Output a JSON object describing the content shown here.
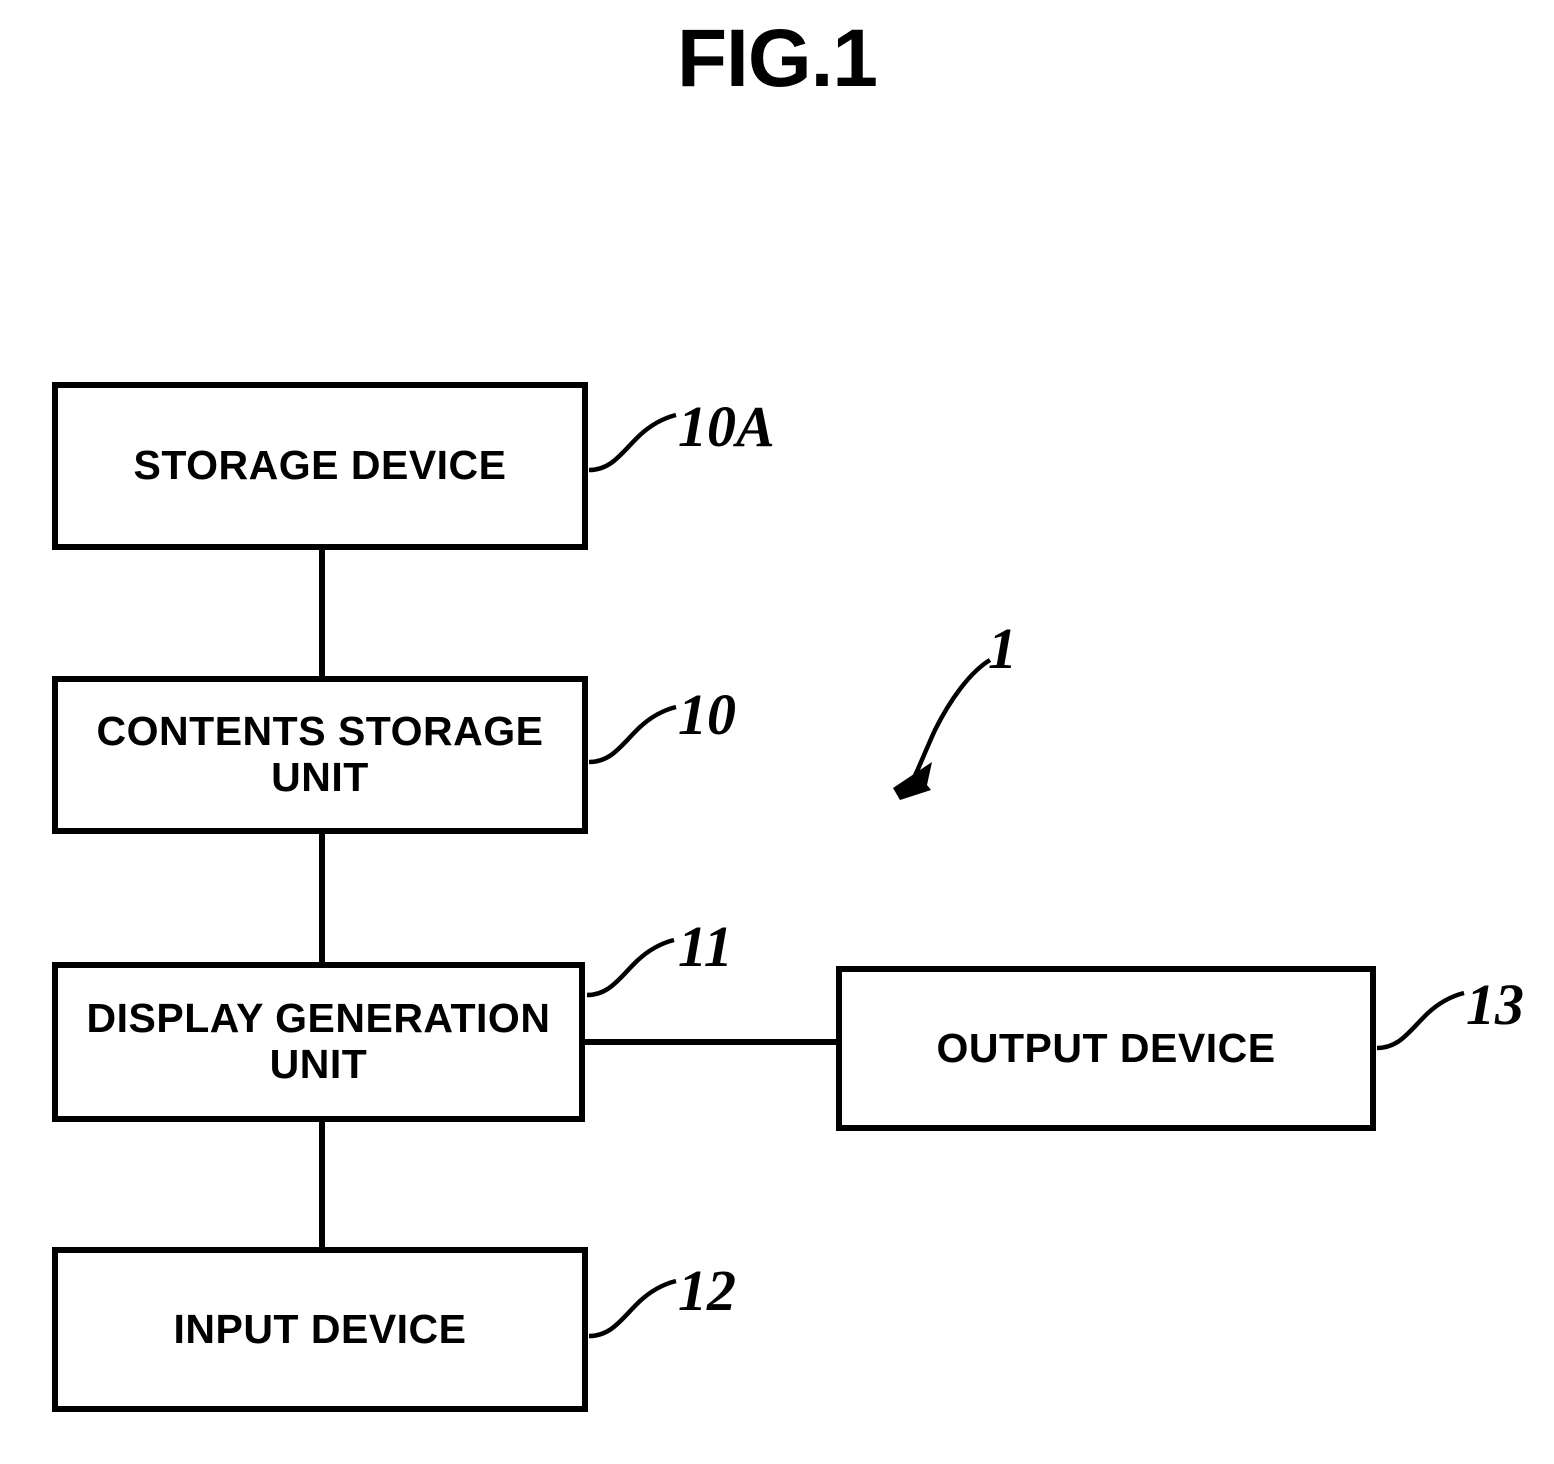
{
  "figure": {
    "title": "FIG.1",
    "system_ref": "1"
  },
  "nodes": [
    {
      "id": "storage-device",
      "label": "STORAGE DEVICE",
      "ref": "10A"
    },
    {
      "id": "contents-storage-unit",
      "label": "CONTENTS STORAGE\nUNIT",
      "ref": "10"
    },
    {
      "id": "display-generation-unit",
      "label": "DISPLAY GENERATION\nUNIT",
      "ref": "11"
    },
    {
      "id": "input-device",
      "label": "INPUT DEVICE",
      "ref": "12"
    },
    {
      "id": "output-device",
      "label": "OUTPUT DEVICE",
      "ref": "13"
    }
  ],
  "colors": {
    "line": "#000000",
    "background": "#ffffff",
    "text": "#000000"
  }
}
